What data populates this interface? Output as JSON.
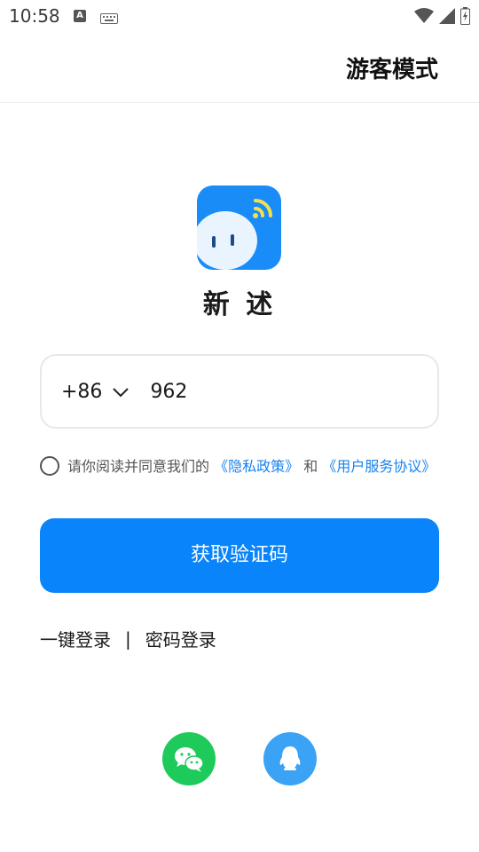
{
  "status_bar": {
    "time": "10:58"
  },
  "header": {
    "guest_mode": "游客模式"
  },
  "app": {
    "name": "新 述"
  },
  "phone": {
    "country_code": "+86",
    "value": "962"
  },
  "agreement": {
    "prefix": "请你阅读并同意我们的",
    "privacy_link": "《隐私政策》",
    "and_text": "和",
    "terms_link": "《用户服务协议》"
  },
  "actions": {
    "get_code": "获取验证码",
    "one_click_login": "一键登录",
    "separator": "|",
    "password_login": "密码登录"
  },
  "social": {
    "wechat_icon": "wechat-icon",
    "qq_icon": "qq-icon"
  },
  "colors": {
    "accent": "#0a84fa",
    "link": "#1683f0",
    "wechat": "#1ecb5a",
    "qq": "#3aa3f5"
  }
}
